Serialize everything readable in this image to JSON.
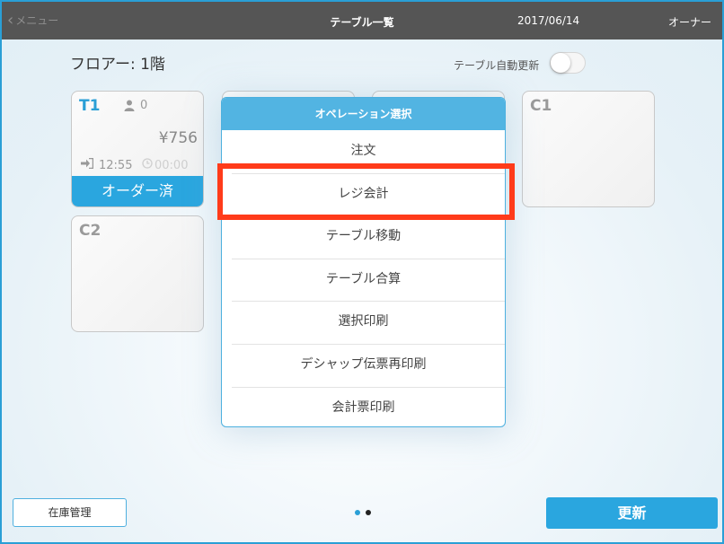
{
  "topbar": {
    "back_label": "メニュー",
    "title": "テーブル一覧",
    "date": "2017/06/14",
    "user": "オーナー"
  },
  "floor": {
    "label": "フロアー: 1階"
  },
  "auto_update": {
    "label": "テーブル自動更新",
    "on": false
  },
  "tables": [
    {
      "name": "T1",
      "guests": "0",
      "amount": "¥756",
      "checkin_time": "12:55",
      "elapsed": "00:00",
      "status": "オーダー済"
    },
    {
      "name": "C1"
    },
    {
      "name": "C2"
    }
  ],
  "popover": {
    "title": "オペレーション選択",
    "items": [
      {
        "label": "注文"
      },
      {
        "label": "レジ会計"
      },
      {
        "label": "テーブル移動"
      },
      {
        "label": "テーブル合算"
      },
      {
        "label": "選択印刷"
      },
      {
        "label": "デシャップ伝票再印刷"
      },
      {
        "label": "会計票印刷"
      }
    ]
  },
  "bottom": {
    "stock_label": "在庫管理",
    "refresh_label": "更新",
    "page_count": 2,
    "current_page": 1
  },
  "colors": {
    "accent": "#2aa6df",
    "topbar": "#555555",
    "highlight": "#ff3b1a"
  }
}
